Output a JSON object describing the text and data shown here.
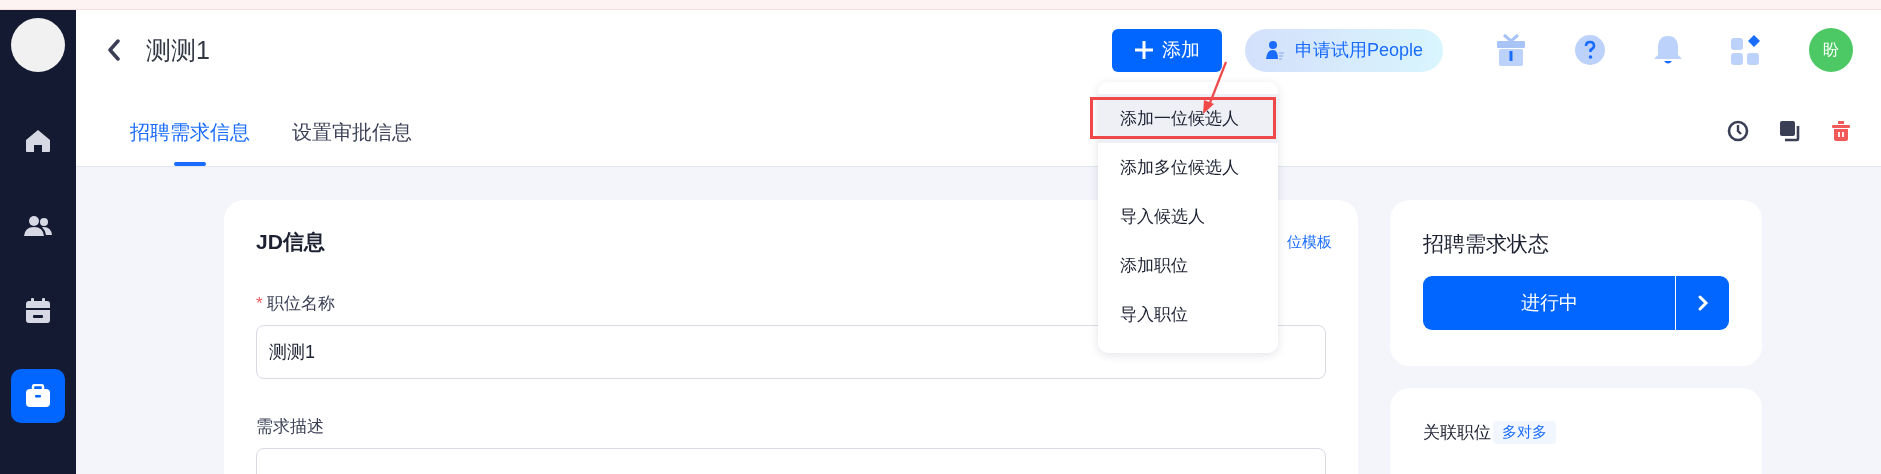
{
  "sidebar": {
    "nav": [
      {
        "kind": "home",
        "selected": false
      },
      {
        "kind": "people",
        "selected": false
      },
      {
        "kind": "calendar",
        "selected": false
      },
      {
        "kind": "briefcase",
        "selected": true
      }
    ]
  },
  "header": {
    "title": "测测1",
    "add_button": "添加",
    "trial_button": "申请试用People",
    "avatar": "盼"
  },
  "tabs": [
    {
      "label": "招聘需求信息",
      "selected": true
    },
    {
      "label": "设置审批信息",
      "selected": false
    }
  ],
  "add_menu": {
    "items": [
      {
        "label": "添加一位候选人",
        "selected": true
      },
      {
        "label": "添加多位候选人",
        "selected": false
      },
      {
        "label": "导入候选人",
        "selected": false
      },
      {
        "label": "添加职位",
        "selected": false
      },
      {
        "label": "导入职位",
        "selected": false
      }
    ]
  },
  "jd_card": {
    "title": "JD信息",
    "template_link": "位模板",
    "fields": [
      {
        "kind": "input",
        "label": "职位名称",
        "required_mark": "*",
        "value": "测测1"
      },
      {
        "kind": "editor",
        "label": "需求描述"
      }
    ]
  },
  "status_card": {
    "title": "招聘需求状态",
    "status": "进行中"
  },
  "linked_card": {
    "title": "关联职位",
    "badge": "多对多"
  }
}
